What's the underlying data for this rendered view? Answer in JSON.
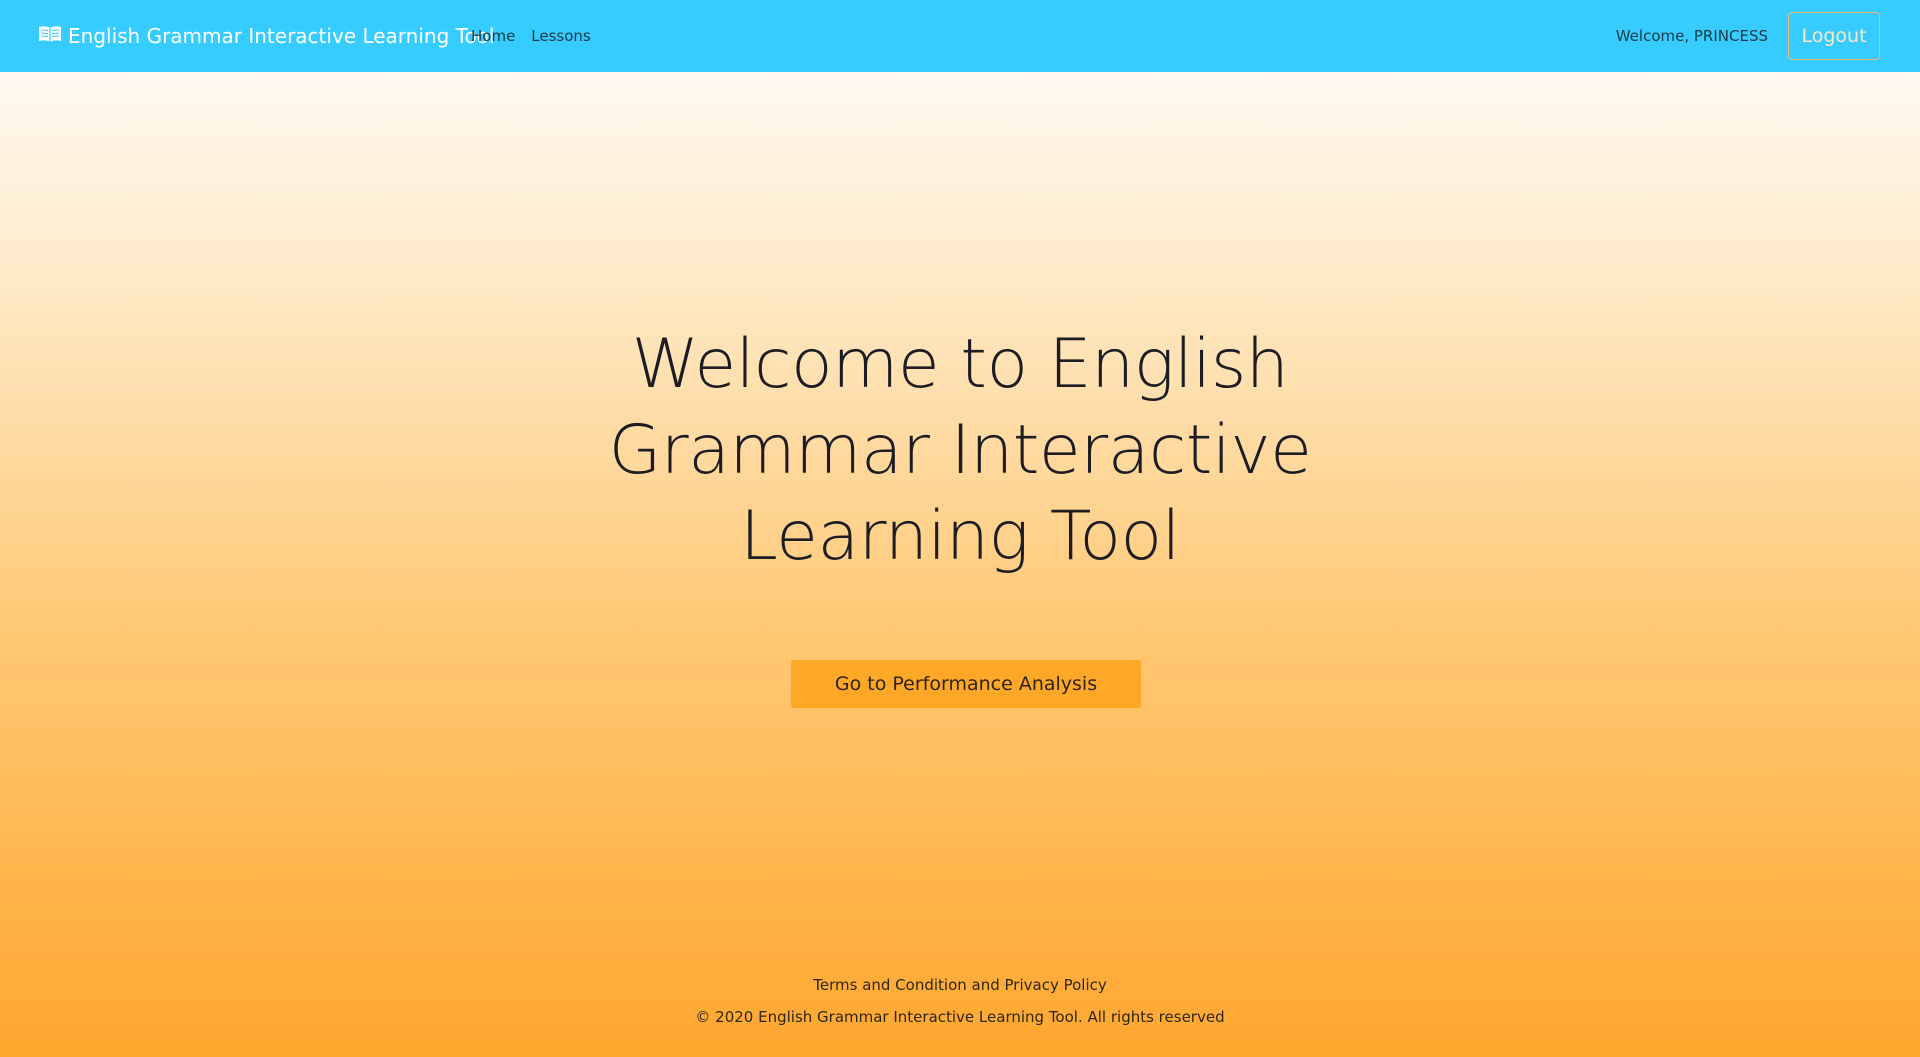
{
  "navbar": {
    "brand_icon": "open-book-icon",
    "brand_title": "English Grammar Interactive Learning Tool",
    "links": [
      {
        "label": "Home"
      },
      {
        "label": "Lessons"
      }
    ],
    "welcome_text": "Welcome, PRINCESS",
    "logout_label": "Logout"
  },
  "hero": {
    "title": "Welcome to English Grammar Interactive Learning Tool",
    "cta_label": "Go to Performance Analysis"
  },
  "footer": {
    "terms_link": "Terms and Condition and Privacy Policy",
    "copyright": "© 2020 English Grammar Interactive Learning Tool. All rights reserved"
  },
  "colors": {
    "navbar_bg": "#36ccff",
    "cta_bg": "#ffa726",
    "gradient_top": "#ffffff",
    "gradient_bottom": "#ffa72e"
  }
}
